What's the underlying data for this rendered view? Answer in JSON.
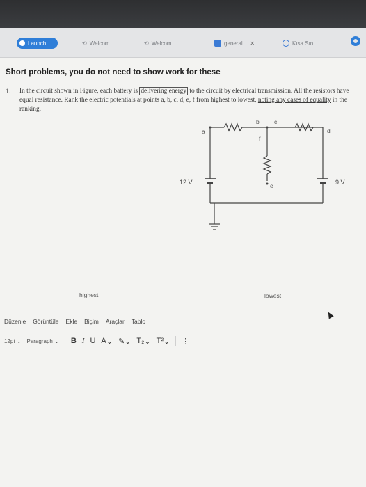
{
  "tabs": [
    {
      "label": "Launch..."
    },
    {
      "label": "Welcom..."
    },
    {
      "label": "Welcom..."
    },
    {
      "label": "general..."
    },
    {
      "label": "Kısa Sın..."
    }
  ],
  "question": {
    "heading": "Short problems, you do not need to show work for these",
    "number": "1.",
    "text_part1": "In the circuit shown in Figure, each battery is ",
    "boxed": "delivering energy",
    "text_part2": " to the circuit by electrical transmission. All the resistors have equal resistance. Rank the electric potentials at points a, b, c, d, e, f from highest to lowest, ",
    "underlined": "noting any cases of equality",
    "text_part3": " in the ranking."
  },
  "circuit": {
    "battery_left": "12 V",
    "battery_right": "9 V",
    "points": {
      "a": "a",
      "b": "b",
      "c": "c",
      "d": "d",
      "e": "e",
      "f": "f"
    }
  },
  "ranking": {
    "highest": "highest",
    "lowest": "lowest"
  },
  "editor": {
    "menu": [
      "Düzenle",
      "Görüntüle",
      "Ekle",
      "Biçim",
      "Araçlar",
      "Tablo"
    ],
    "font_size": "12pt",
    "paragraph": "Paragraph",
    "bold": "B",
    "italic": "I",
    "underline": "U",
    "font_color": "A",
    "highlight": "✎",
    "subscript": "T₂",
    "superscript": "T²",
    "more": "⋮"
  }
}
